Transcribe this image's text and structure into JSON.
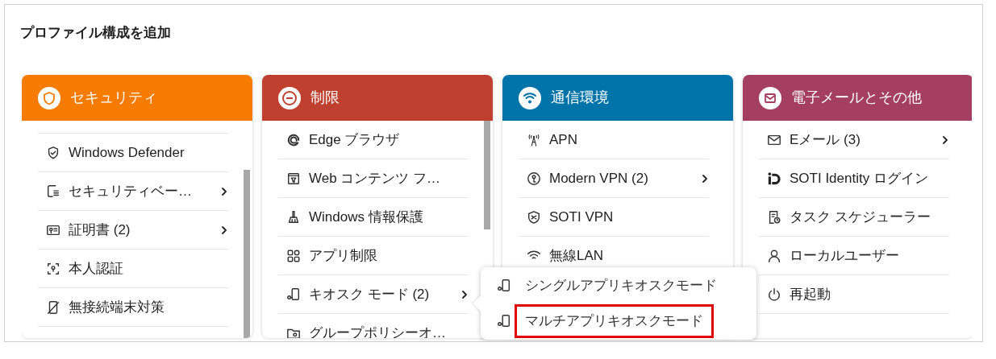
{
  "title": "プロファイル構成を追加",
  "columns": [
    {
      "title": "セキュリティ",
      "color": "#f57c00",
      "scrolled": true,
      "items": [
        {
          "label": "Windows Defender",
          "submenu": false
        },
        {
          "label": "セキュリティベー…",
          "submenu": true
        },
        {
          "label": "証明書 (2)",
          "submenu": true
        },
        {
          "label": "本人認証",
          "submenu": false
        },
        {
          "label": "無接続端末対策",
          "submenu": false
        }
      ]
    },
    {
      "title": "制限",
      "color": "#c0402f",
      "scrolled": false,
      "items": [
        {
          "label": "Edge ブラウザ",
          "submenu": false
        },
        {
          "label": "Web コンテンツ フ…",
          "submenu": false
        },
        {
          "label": "Windows 情報保護",
          "submenu": false
        },
        {
          "label": "アプリ制限",
          "submenu": false
        },
        {
          "label": "キオスク モード (2)",
          "submenu": true
        },
        {
          "label": "グループポリシーオ…",
          "submenu": false
        }
      ]
    },
    {
      "title": "通信環境",
      "color": "#0073a8",
      "scrolled": false,
      "items": [
        {
          "label": "APN",
          "submenu": false
        },
        {
          "label": "Modern VPN (2)",
          "submenu": true
        },
        {
          "label": "SOTI VPN",
          "submenu": false
        },
        {
          "label": "無線LAN",
          "submenu": false
        }
      ]
    },
    {
      "title": "電子メールとその他",
      "color": "#a43f62",
      "scrolled": false,
      "items": [
        {
          "label": "Eメール (3)",
          "submenu": true
        },
        {
          "label": "SOTI Identity ログイン",
          "submenu": false
        },
        {
          "label": "タスク スケジューラー",
          "submenu": false
        },
        {
          "label": "ローカルユーザー",
          "submenu": false
        },
        {
          "label": "再起動",
          "submenu": false
        }
      ]
    }
  ],
  "popup": {
    "items": [
      {
        "label": "シングルアプリキオスクモード",
        "highlighted": false
      },
      {
        "label": "マルチアプリキオスクモード",
        "highlighted": true
      }
    ]
  }
}
